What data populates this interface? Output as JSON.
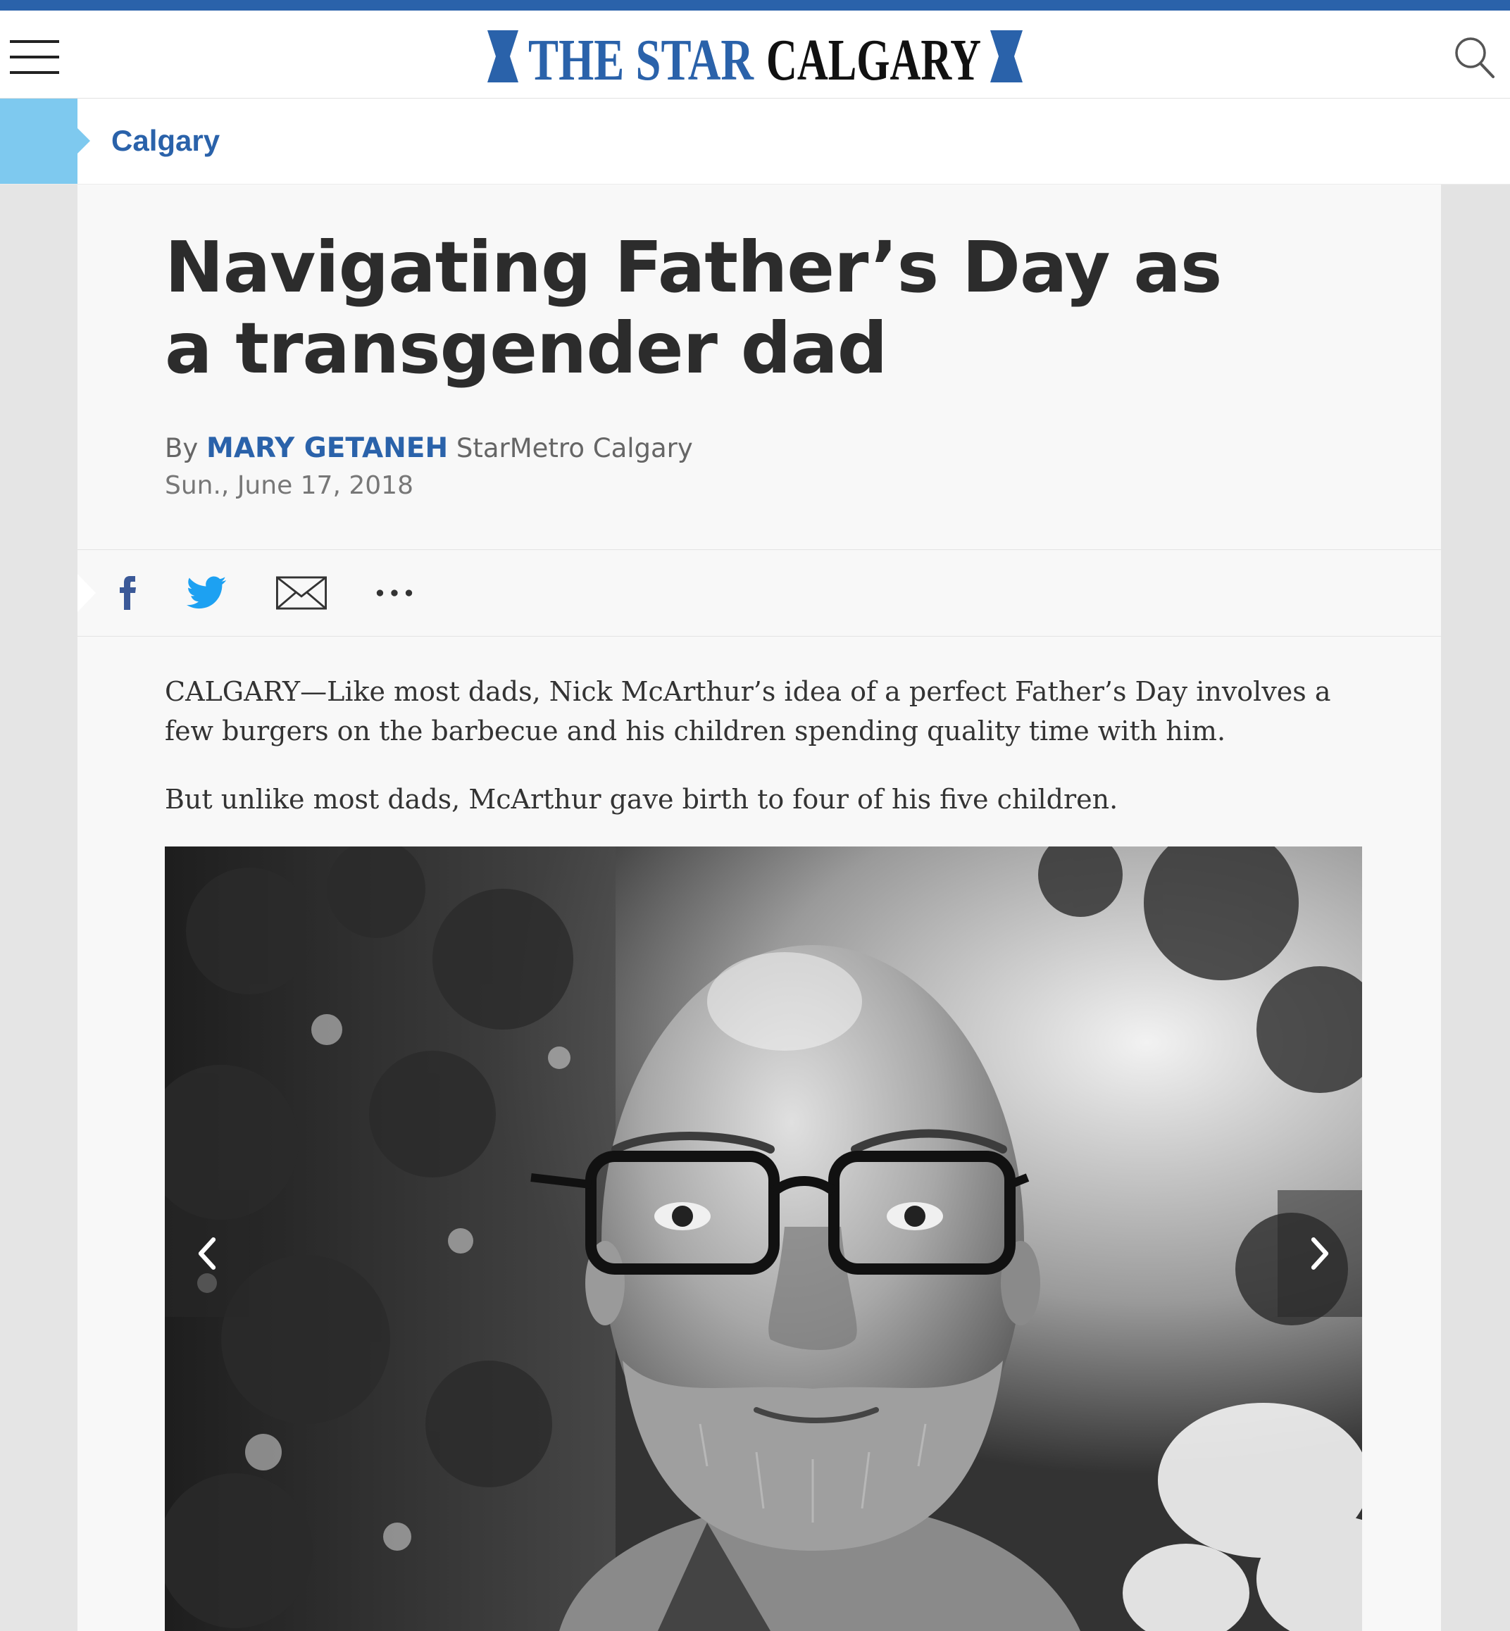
{
  "brand": {
    "name_part1": "THE STAR",
    "name_part2": "CALGARY",
    "color_primary": "#2a62aa",
    "color_section_tab": "#7ec9ef"
  },
  "header": {
    "menu_icon": "hamburger-menu-icon",
    "search_icon": "search-icon"
  },
  "section": {
    "label": "Calgary"
  },
  "article": {
    "headline": "Navigating Father’s Day as a transgender dad",
    "byline_prefix": "By",
    "author": "MARY GETANEH",
    "outlet": "StarMetro Calgary",
    "date": "Sun., June 17, 2018",
    "paragraphs": [
      "CALGARY—Like most dads, Nick McArthur’s idea of a perfect Father’s Day involves a few burgers on the barbecue and his children spending quality time with him.",
      "But unlike most dads, McArthur gave birth to four of his five children."
    ]
  },
  "share": {
    "items": [
      "facebook-icon",
      "twitter-icon",
      "email-icon",
      "more-options-icon"
    ],
    "facebook_color": "#3b5998",
    "twitter_color": "#1da1f2"
  },
  "gallery": {
    "prev_icon": "chevron-left-icon",
    "next_icon": "chevron-right-icon"
  }
}
